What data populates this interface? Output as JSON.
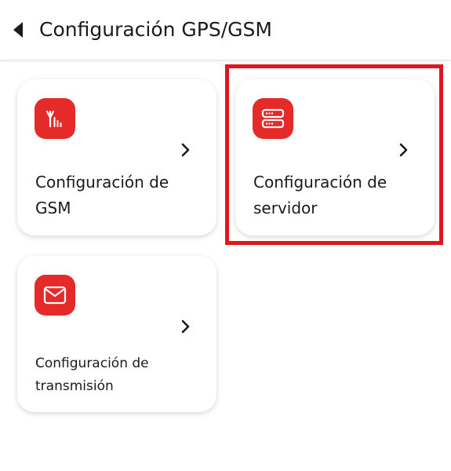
{
  "header": {
    "title": "Configuración GPS/GSM",
    "back_icon": "caret-left-icon"
  },
  "cards": [
    {
      "label": "Configuración de GSM",
      "icon": "signal-antenna-icon"
    },
    {
      "label": "Configuración de servidor",
      "icon": "server-icon"
    },
    {
      "label": "Configuración de transmisión",
      "icon": "envelope-icon"
    }
  ],
  "colors": {
    "accent": "#e52a2a",
    "highlight": "#e0161e",
    "card_bg": "#ffffff",
    "text": "#1b1b1b"
  }
}
